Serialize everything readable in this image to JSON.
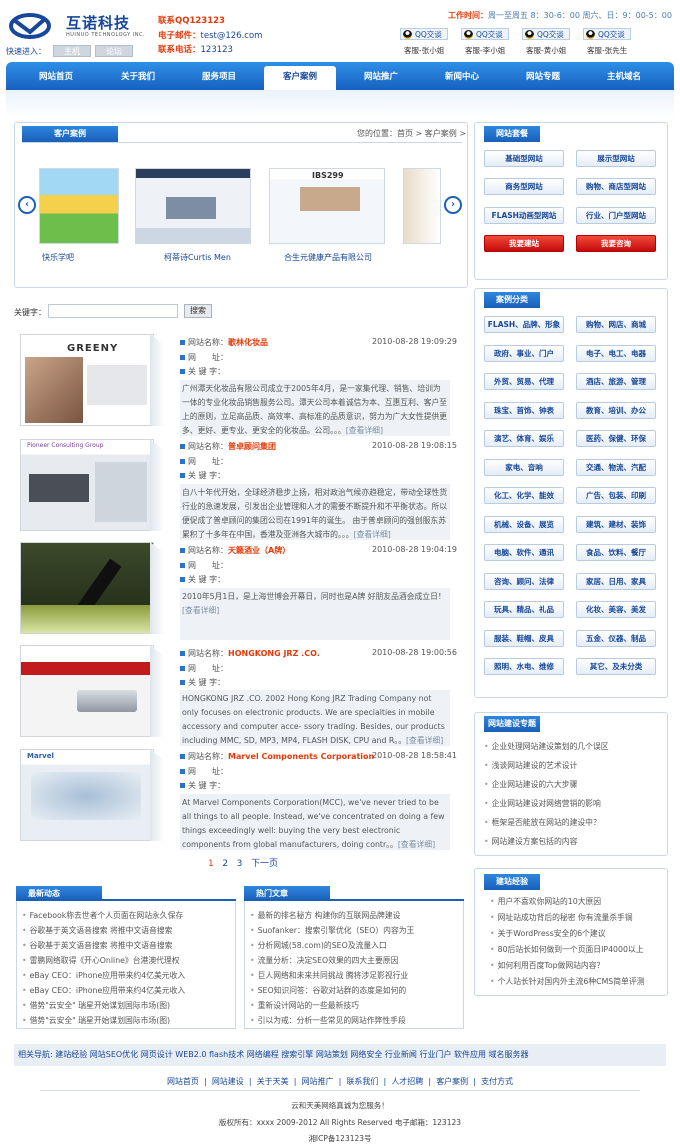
{
  "header": {
    "logo_cn": "互诺科技",
    "logo_en": "HUINUO TECHNOLOGY INC.",
    "quick_label": "快速进入：",
    "quick_links": [
      "主机",
      "论坛"
    ],
    "contact": [
      {
        "label": "联系QQ",
        "value": "123123"
      },
      {
        "label": "电子邮件：",
        "value": "test@126.com"
      },
      {
        "label": "联系电话：",
        "value": "123123"
      }
    ],
    "hours_label": "工作时间：",
    "hours_value": "周一至周五 8：30-6：00 周六、日：9：00-5：00",
    "qq_button": "QQ交谈",
    "qq_staff": [
      "客服-张小姐",
      "客服-李小姐",
      "客服-黄小姐",
      "客服-张先生"
    ]
  },
  "nav": [
    "网站首页",
    "关于我们",
    "服务项目",
    "客户案例",
    "网站推广",
    "新闻中心",
    "网站专题",
    "主机域名"
  ],
  "nav_active": 3,
  "cases_panel": {
    "title": "客户案例",
    "breadcrumb": "您的位置：首页 > 客户案例 >",
    "captions": [
      "快乐学吧",
      "柯蒂诗Curtis Men",
      "合生元健康产品有限公司"
    ]
  },
  "search": {
    "label": "关键字：",
    "button": "搜索"
  },
  "labels": {
    "name": "网站名称：",
    "url": "网　　址：",
    "keywords": "关  键  字："
  },
  "case_list": [
    {
      "name": "歌林化妆品",
      "date": "2010-08-28 19:09:29",
      "desc": "广州潭天化妆品有限公司成立于2005年4月，是一家集代理、销售、培训为一体的专业化妆品销售服务公司。潭天公司本着诚信为本、互惠互利、客户至上的原则，立足高品质、高效率、高标准的品质意识，努力为广大女性提供更多、更好、更专业、更安全的化妆品。公司。。。"
    },
    {
      "name": "普卓顾问集团",
      "date": "2010-08-28 19:08:15",
      "desc": "自八十年代开始，全球经济稳步上扬，相对政治气候亦趋稳定，带动全球性货行业的急速发展，引发出企业管理和人才的需要不断提升和不平衡状态。所以便促成了普卓顾问的集团公司在1991年的诞生。 由于普卓顾问的强创服东苏累积了十多年在中国，香港及亚洲各大城市的。。。"
    },
    {
      "name": "天籁酒业（A牌）",
      "date": "2010-08-28 19:04:19",
      "desc": "2010年5月1日，是上海世博会开幕日，同时也是A牌 好朋友品酒会成立日！"
    },
    {
      "name": "HONGKONG JRZ .CO.",
      "date": "2010-08-28 19:00:56",
      "desc": "HONGKONG JRZ .CO. 2002 Hong Kong JRZ Trading Company not only focuses on electronic products. We are specialties in mobile accessory and computer acce- ssory trading. Besides, our products including MMC, SD, MP3, MP4, FLASH DISK, CPU and R。。"
    },
    {
      "name": "Marvel Components Corporation",
      "date": "2010-08-28 18:58:41",
      "desc": "At Marvel Components Corporation(MCC), we've never tried to be all things to all people. Instead, we've concentrated on doing a few things exceedingly well: buying the very best electronic components from global manufacturers, doing contr。。"
    }
  ],
  "more_label": "[查看详细]",
  "pager": {
    "pages": [
      "1",
      "2",
      "3"
    ],
    "next": "下一页"
  },
  "packages": {
    "title": "网站套餐",
    "items": [
      "基础型网站",
      "展示型网站",
      "商务型网站",
      "购物、商店型网站",
      "FLASH动画型网站",
      "行业、门户型网站"
    ],
    "build": "我要建站",
    "consult": "我要咨询"
  },
  "categories": {
    "title": "案例分类",
    "items": [
      "FLASH、品牌、形象",
      "购物、网店、商城",
      "政府、事业、门户",
      "电子、电工、电器",
      "外贸、贸易、代理",
      "酒店、旅游、管理",
      "珠宝、首饰、钟表",
      "教育、培训、办公",
      "演艺、体育、娱乐",
      "医药、保健、环保",
      "家电、音响",
      "交通、物流、汽配",
      "化工、化学、能效",
      "广告、包装、印刷",
      "机械、设备、展览",
      "建筑、建材、装饰",
      "电脑、软件、通讯",
      "食品、饮料、餐厅",
      "咨询、顾问、法律",
      "家居、日用、家具",
      "玩具、精品、礼品",
      "化妆、美容、美发",
      "服装、鞋帽、皮具",
      "五金、仪器、制品",
      "照明、水电、维修",
      "其它、及未分类"
    ]
  },
  "topics": {
    "title": "网站建设专题",
    "items": [
      "企业处理网站建设策划的几个误区",
      "浅谈网站建设的艺术设计",
      "企业网站建设的六大步骤",
      "企业网站建设对网络营销的影响",
      "框架是否能放在网站的建设中？",
      "网站建设方案包括的内容"
    ]
  },
  "experience": {
    "title": "建站经验",
    "items": [
      "用户不喜欢你网站的10大原因",
      "网址站成功背后的秘密 你有流量杀手锏",
      "关于WordPress安全的6个建议",
      "80后站长如何做到一个页面日IP4000以上",
      "如何利用百度Top做网站内容？",
      "个人站长针对国内外主流6种CMS简单评测"
    ]
  },
  "latest": {
    "title": "最新动态",
    "items": [
      "Facebook称去世者个人页面在网站永久保存",
      "谷歌基于英文语音搜索 将推中文语音搜索",
      "谷歌基于英文语音搜索 将推中文语音搜索",
      "雷鹏网络取得《开心Online》台港澳代理权",
      "eBay CEO：iPhone应用带来约4亿美元收入",
      "eBay CEO：iPhone应用带来约4亿美元收入",
      "借势\"云安全\" 瑞星开始谋划国际市场(图)",
      "借势\"云安全\" 瑞星开始谋划国际市场(图)"
    ]
  },
  "hot": {
    "title": "热门文章",
    "items": [
      "最新的排名秘方 构建你的互联网品牌建设",
      "Suofanker：搜索引擎优化（SEO）内容为王",
      "分析网城(58.com)的SEO及流量入口",
      "流量分析：决定SEO效果的四大主要原因",
      "巨人网络和未来共同挑战 腾将涉足影视行业",
      "SEO知识问答：谷歌对站群的态度是如何的",
      "重新设计网站的一些最新技巧",
      "引以为戒：分析一些常见的网站作弊性手段"
    ]
  },
  "related": "相关导航: 建站经验 网站SEO优化 网页设计 WEB2.0 flash技术 网络编程 搜索引擎 网站策划 网络安全 行业新闻 行业门户 软件应用 域名服务器",
  "footer": {
    "nav": [
      "网站首页",
      "网站建设",
      "关于天美",
      "网站推广",
      "联系我们",
      "人才招聘",
      "客户案例",
      "支付方式"
    ],
    "line1": "云和天美网络真诚为您服务！",
    "line2": "版权所有：xxxx 2009-2012 All Rights Reserved 电子邮箱：123123",
    "line3": "湘ICP备123123号"
  },
  "colors": {
    "brand": "#1a5fb8",
    "accent": "#e23b0a"
  }
}
